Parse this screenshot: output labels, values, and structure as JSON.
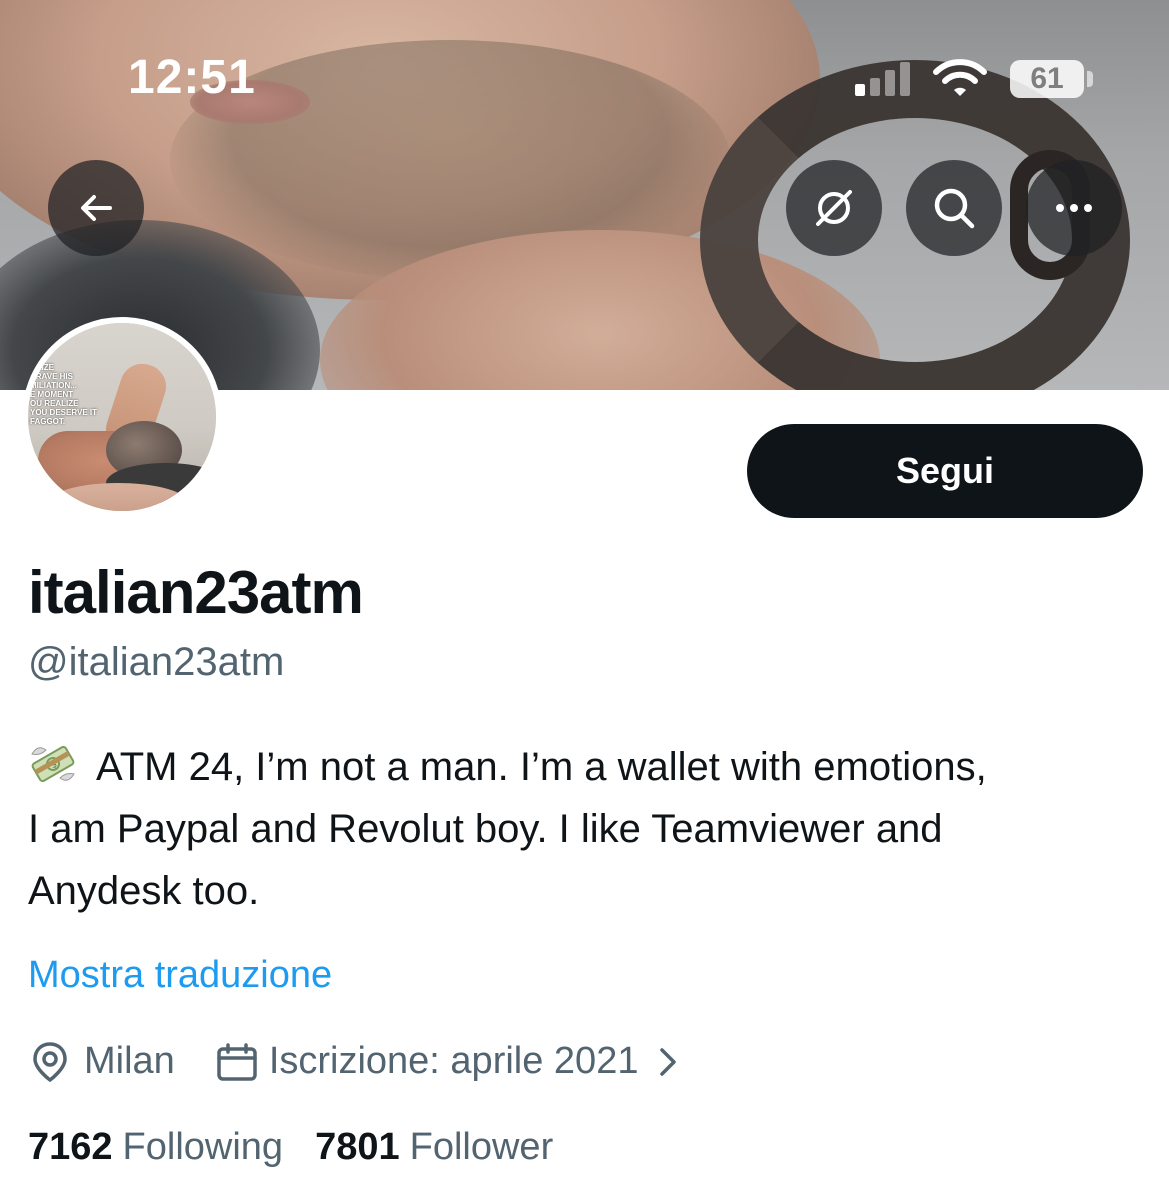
{
  "status_bar": {
    "time": "12:51",
    "battery": "61"
  },
  "nav": {
    "back_icon": "arrow-left-icon",
    "grok_icon": "grok-slash-icon",
    "search_icon": "search-icon",
    "more_icon": "more-horizontal-icon"
  },
  "avatar_caption": [
    "...LIZE",
    "CRAVE HIS",
    "MILIATION...",
    "E MOMENT",
    "OU REALIZE",
    "YOU DESERVE IT",
    "FAGGOT."
  ],
  "profile": {
    "follow_label": "Segui",
    "display_name": "italian23atm",
    "handle": "@italian23atm",
    "bio_lines": [
      "ATM 24, I’m not a man. I’m a wallet with emotions,",
      "I am Paypal and Revolut boy. I like Teamviewer and",
      "Anydesk too."
    ],
    "bio_emoji": "money-with-wings-icon",
    "translate_label": "Mostra traduzione",
    "location": "Milan",
    "joined": "Iscrizione: aprile 2021",
    "following_count": "7162",
    "following_label": "Following",
    "followers_count": "7801",
    "followers_label": "Follower"
  },
  "colors": {
    "text_primary": "#0f1419",
    "text_secondary": "#536471",
    "link": "#1d9bf0",
    "button_bg": "#0f1419"
  }
}
